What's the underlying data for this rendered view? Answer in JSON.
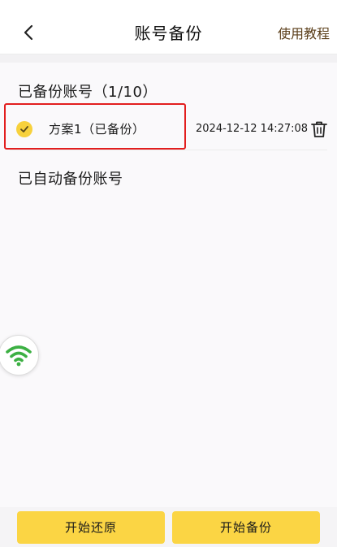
{
  "header": {
    "title": "账号备份",
    "tutorial_label": "使用教程",
    "back_icon": "chevron-left-icon"
  },
  "backed_up": {
    "title": "已备份账号（1/10）",
    "items": [
      {
        "name": "方案1（已备份）",
        "timestamp": "2024-12-12 14:27:08",
        "selected": true
      }
    ]
  },
  "auto_backup": {
    "title": "已自动备份账号"
  },
  "floating": {
    "icon": "wifi-icon",
    "color": "#3cb043"
  },
  "actions": {
    "restore_label": "开始还原",
    "backup_label": "开始备份"
  },
  "colors": {
    "accent": "#fbd544",
    "check": "#f7d13c",
    "highlight": "#e21e1e",
    "tutorial_text": "#5a3d18"
  }
}
